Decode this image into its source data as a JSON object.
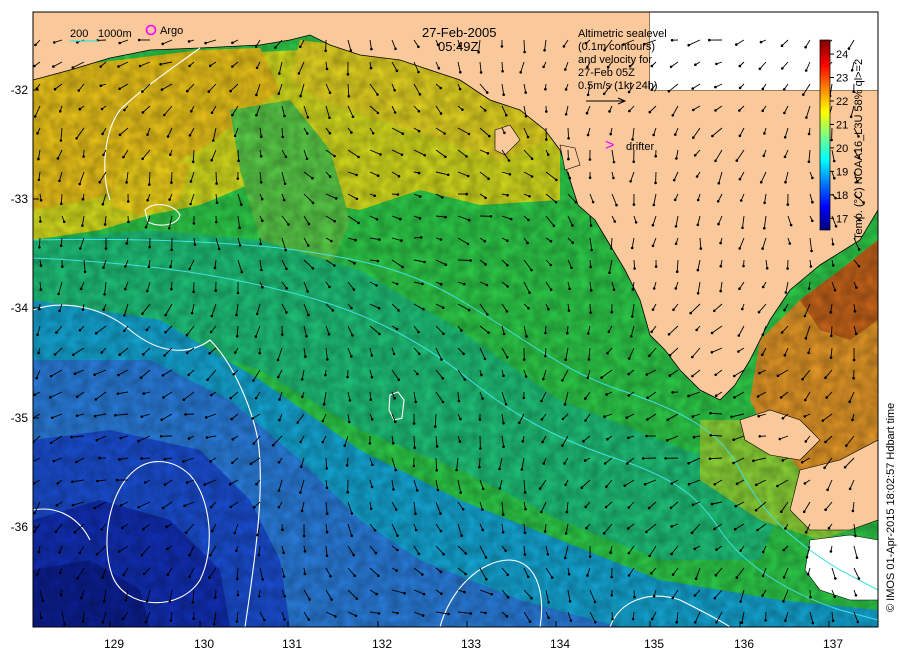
{
  "map": {
    "title_date": "27-Feb-2005",
    "title_time": "05:49Z",
    "legend_scale": {
      "d1": "200",
      "d2": "1000m"
    },
    "argo_label": "Argo",
    "drifter_label": "drifter",
    "drifter_marker": ">",
    "altimetry_note": [
      "Altimetric sealevel",
      "(0.1m contours)",
      "and velocity for",
      "27-Feb 05Z",
      "0.5m/s (1kt 24h)"
    ],
    "colorbar": {
      "label": "Temp. (°C) NOAA16_L3U 58% ql>=2",
      "ticks": [
        "24",
        "23",
        "22",
        "21",
        "20",
        "19",
        "18",
        "17"
      ],
      "min": 16.5,
      "max": 24.6,
      "colors": [
        "#00007f",
        "#0000ff",
        "#007fff",
        "#00ffff",
        "#7fff7f",
        "#ffff00",
        "#ff7f00",
        "#ff0000",
        "#7f0000"
      ]
    },
    "credit": "© IMOS 01-Apr-2015 18:02:57 Hdbart time",
    "lon_ticks": [
      "129",
      "130",
      "131",
      "132",
      "133",
      "134",
      "135",
      "136",
      "137"
    ],
    "lat_ticks": [
      "-32",
      "-33",
      "-34",
      "-35",
      "-36"
    ],
    "colors": {
      "land": "#f9c89b",
      "isobath": "#40e0e0",
      "sealevel_contour": "#ffffff",
      "arrow": "#000000",
      "argo": "#ff00ff",
      "drifter": "#ff00ff"
    }
  }
}
